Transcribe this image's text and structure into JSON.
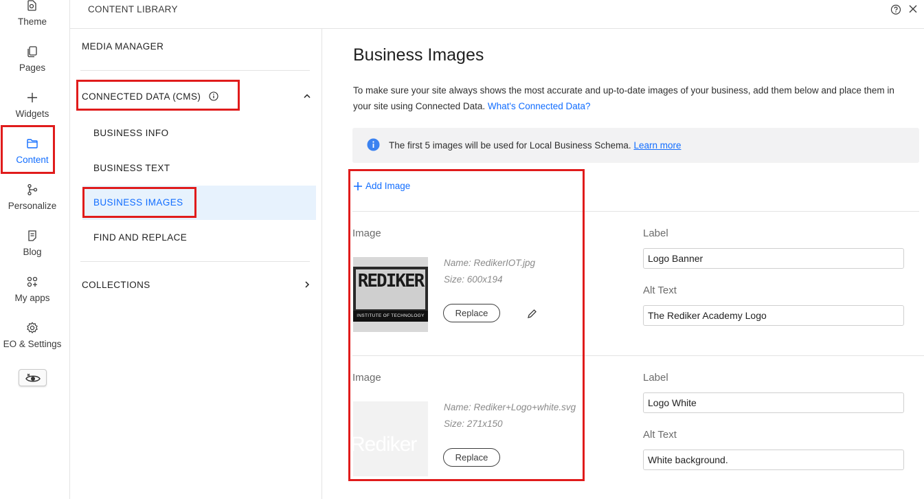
{
  "rail": {
    "items": [
      {
        "label": "Theme",
        "icon": "theme-icon"
      },
      {
        "label": "Pages",
        "icon": "pages-icon"
      },
      {
        "label": "Widgets",
        "icon": "plus-icon"
      },
      {
        "label": "Content",
        "icon": "folder-icon",
        "active": true
      },
      {
        "label": "Personalize",
        "icon": "branch-icon"
      },
      {
        "label": "Blog",
        "icon": "blog-icon"
      },
      {
        "label": "My apps",
        "icon": "apps-icon"
      },
      {
        "label": "EO & Settings",
        "icon": "gear-icon"
      }
    ],
    "preview_icon": "hidden-eye-icon"
  },
  "topbar": {
    "title": "CONTENT LIBRARY",
    "help_icon": "help-icon",
    "close_icon": "close-icon"
  },
  "nav": {
    "media_manager": "MEDIA MANAGER",
    "connected_data": "CONNECTED DATA (CMS)",
    "sub_items": [
      "BUSINESS INFO",
      "BUSINESS TEXT",
      "BUSINESS IMAGES",
      "FIND AND REPLACE"
    ],
    "selected": "BUSINESS IMAGES",
    "collections": "COLLECTIONS"
  },
  "main": {
    "title": "Business Images",
    "intro": "To make sure your site always shows the most accurate and up-to-date images of your business, add them below and place them in your site using Connected Data.",
    "intro_link": "What's Connected Data?",
    "banner_text": "The first 5 images will be used for Local Business Schema.",
    "banner_link": "Learn more",
    "add_image": "Add Image",
    "images": [
      {
        "image_label": "Image",
        "name": "Name: RedikerIOT.jpg",
        "size": "Size: 600x194",
        "replace": "Replace",
        "label_title": "Label",
        "label_value": "Logo Banner",
        "alt_title": "Alt Text",
        "alt_value": "The Rediker Academy Logo",
        "thumb_text": "REDIKER",
        "thumb_subtext": "INSTITUTE OF TECHNOLOGY"
      },
      {
        "image_label": "Image",
        "name": "Name: Rediker+Logo+white.svg",
        "size": "Size: 271x150",
        "replace": "Replace",
        "label_title": "Label",
        "label_value": "Logo White",
        "alt_title": "Alt Text",
        "alt_value": "White background.",
        "thumb_text": "Rediker"
      }
    ]
  },
  "colors": {
    "accent": "#116dff",
    "annotation": "#e01b1b",
    "selected_bg": "#e7f2fd"
  }
}
